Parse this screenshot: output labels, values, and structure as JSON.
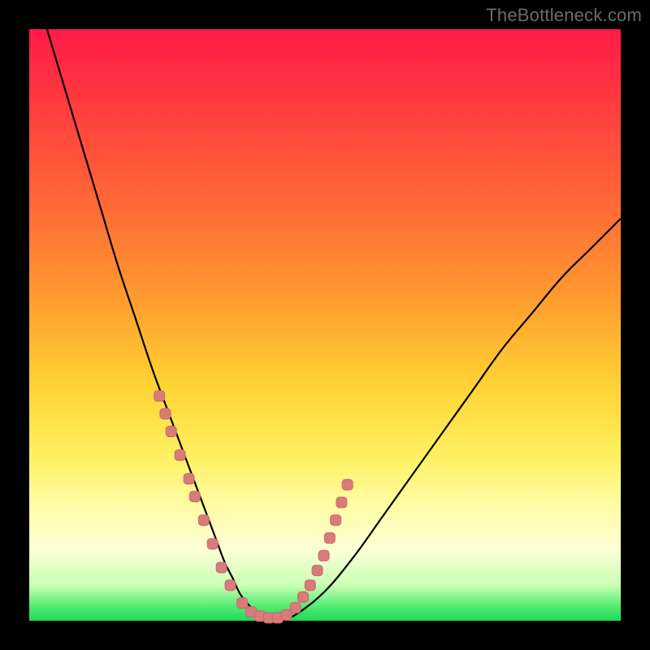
{
  "watermark": "TheBottleneck.com",
  "colors": {
    "curve_stroke": "#000000",
    "marker_fill": "#d97b7b",
    "marker_stroke": "#c86a6a",
    "background_frame": "#000000"
  },
  "chart_data": {
    "type": "line",
    "title": "",
    "xlabel": "",
    "ylabel": "",
    "xlim": [
      0,
      100
    ],
    "ylim": [
      0,
      100
    ],
    "series": [
      {
        "name": "bottleneck-curve",
        "x": [
          3,
          6,
          9,
          12,
          15,
          18,
          21,
          24,
          27,
          30,
          31.5,
          33,
          34.5,
          36,
          39,
          42,
          45,
          50,
          55,
          60,
          65,
          70,
          75,
          80,
          85,
          90,
          95,
          100
        ],
        "y": [
          100,
          90,
          80,
          70,
          60,
          51,
          42,
          34,
          26,
          18,
          14,
          10,
          7,
          4,
          1,
          0,
          1,
          5,
          11,
          18,
          25,
          32,
          39,
          46,
          52,
          58,
          63,
          68
        ]
      }
    ],
    "markers": {
      "name": "highlight-points",
      "x": [
        22,
        23,
        24,
        25.5,
        27,
        28,
        29.5,
        31,
        32.5,
        34,
        36,
        37.5,
        39,
        40.5,
        42,
        43.5,
        45,
        46.3,
        47.5,
        48.7,
        49.8,
        50.8,
        51.8,
        52.8,
        53.8
      ],
      "y": [
        38,
        35,
        32,
        28,
        24,
        21,
        17,
        13,
        9,
        6,
        3,
        1.5,
        0.8,
        0.5,
        0.5,
        1,
        2.2,
        4,
        6,
        8.5,
        11,
        14,
        17,
        20,
        23
      ]
    }
  }
}
